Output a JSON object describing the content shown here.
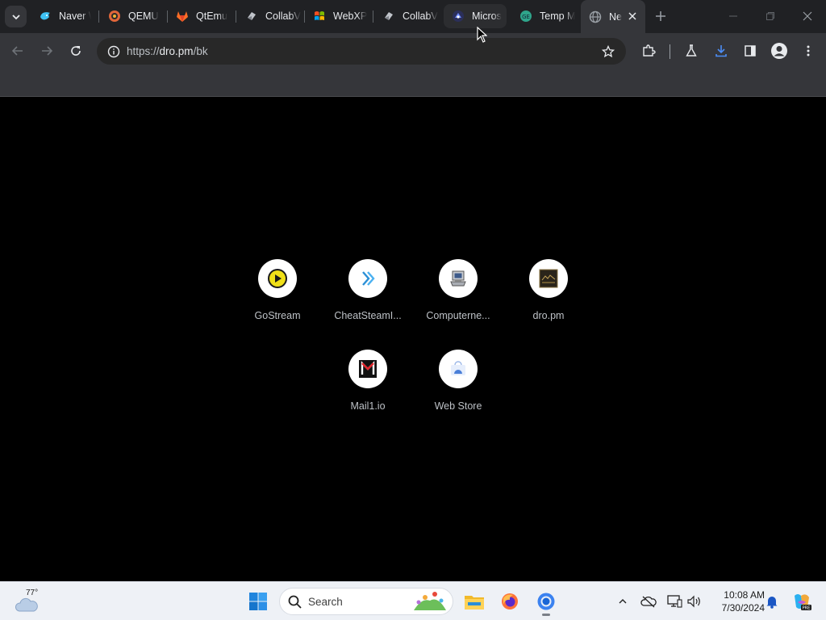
{
  "tabs": [
    {
      "title": "Naver \\",
      "icon": "naver-whale-icon"
    },
    {
      "title": "QEMU",
      "icon": "qemu-icon"
    },
    {
      "title": "QtEmu",
      "icon": "gitlab-icon"
    },
    {
      "title": "CollabV",
      "icon": "collabvm-icon"
    },
    {
      "title": "WebXP",
      "icon": "webxp-icon"
    },
    {
      "title": "CollabV",
      "icon": "collabvm-icon"
    },
    {
      "title": "Micros",
      "icon": "microsoft-icon"
    },
    {
      "title": "Temp M",
      "icon": "temp-mail-icon"
    },
    {
      "title": "Ne",
      "icon": "globe-icon"
    }
  ],
  "toolbar": {
    "url_scheme": "https://",
    "url_host": "dro.pm",
    "url_path": "/bk"
  },
  "shortcuts": [
    {
      "label": "GoStream",
      "icon": "gostream-icon"
    },
    {
      "label": "CheatSteamI...",
      "icon": "double-chevron-icon"
    },
    {
      "label": "Computerne...",
      "icon": "computer-icon"
    },
    {
      "label": "dro.pm",
      "icon": "dro-pm-icon"
    },
    {
      "label": "Mail1.io",
      "icon": "mail1-icon"
    },
    {
      "label": "Web Store",
      "icon": "web-store-icon"
    }
  ],
  "taskbar": {
    "temperature": "77°",
    "search_placeholder": "Search",
    "time": "10:08 AM",
    "date": "7/30/2024"
  },
  "colors": {
    "tabstrip": "#202124",
    "toolbar": "#35363a",
    "content": "#000000",
    "taskbar": "#eef1f6"
  }
}
